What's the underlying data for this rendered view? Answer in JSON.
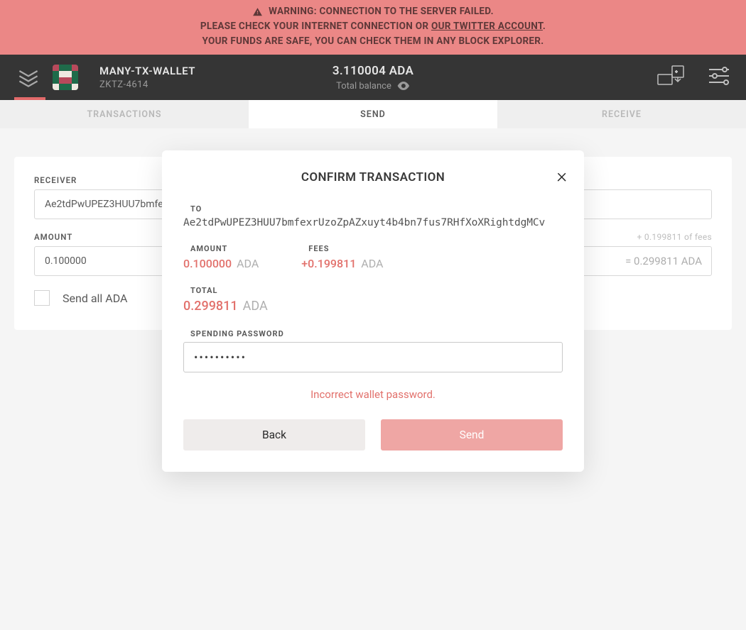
{
  "warning": {
    "line1": "WARNING: CONNECTION TO THE SERVER FAILED.",
    "line2_pre": "PLEASE CHECK YOUR INTERNET CONNECTION OR ",
    "line2_link": "OUR TWITTER ACCOUNT",
    "line2_post": ".",
    "line3": "YOUR FUNDS ARE SAFE, YOU CAN CHECK THEM IN ANY BLOCK EXPLORER."
  },
  "header": {
    "wallet_name": "MANY-TX-WALLET",
    "wallet_sub": "ZKTZ-4614",
    "balance": "3.110004 ADA",
    "balance_label": "Total balance"
  },
  "tabs": {
    "transactions": "TRANSACTIONS",
    "send": "SEND",
    "receive": "RECEIVE"
  },
  "form": {
    "receiver_label": "RECEIVER",
    "receiver_value": "Ae2tdPwUPEZ3HUU7bmfe",
    "amount_label": "AMOUNT",
    "fees_hint": "+ 0.199811 of fees",
    "amount_value": "0.100000",
    "amount_eq": "= 0.299811 ADA",
    "send_all": "Send all ADA"
  },
  "modal": {
    "title": "CONFIRM TRANSACTION",
    "to_label": "TO",
    "to_addr": "Ae2tdPwUPEZ3HUU7bmfexrUzoZpAZxuyt4b4bn7fus7RHfXoXRightdgMCv",
    "amount_label": "AMOUNT",
    "amount_val": "0.100000",
    "fees_label": "FEES",
    "fees_val": "+0.199811",
    "total_label": "TOTAL",
    "total_val": "0.299811",
    "ada": "ADA",
    "pwd_label": "SPENDING PASSWORD",
    "pwd_value": "••••••••••",
    "error": "Incorrect wallet password.",
    "back": "Back",
    "send": "Send"
  }
}
